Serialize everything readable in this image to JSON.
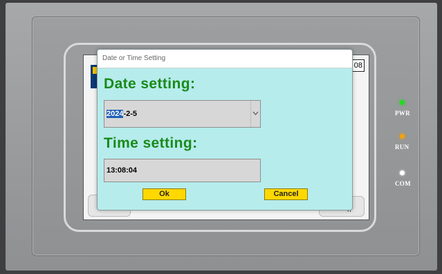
{
  "dialog": {
    "title": "Date or Time Setting",
    "date_heading": "Date setting:",
    "date_selected_part": "2024",
    "date_rest": "-2-5",
    "time_heading": "Time setting:",
    "time_value": "13:08:04",
    "ok_label": "Ok",
    "cancel_label": "Cancel"
  },
  "background": {
    "value_box": "08",
    "right_button_text": "s\nn"
  },
  "indicators": [
    {
      "label": "PWR",
      "color": "#1fdc1f"
    },
    {
      "label": "RUN",
      "color": "#f2a20b"
    },
    {
      "label": "COM",
      "color": "#ffffff"
    }
  ],
  "icons": {
    "dropdown": "chevron-down-icon"
  }
}
